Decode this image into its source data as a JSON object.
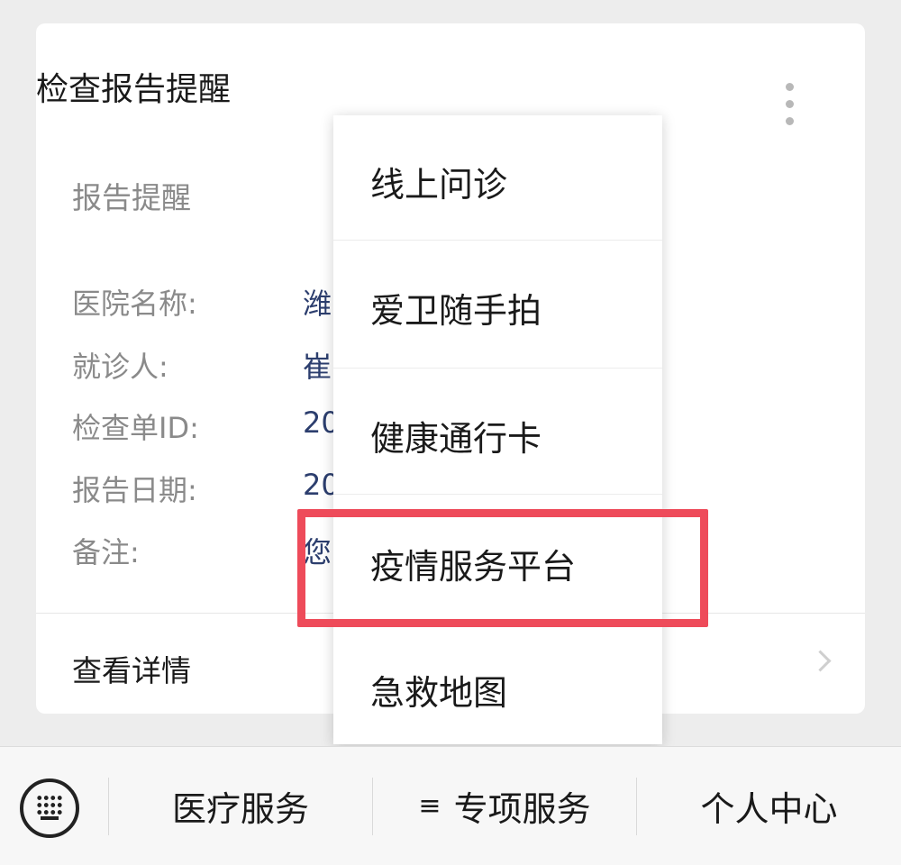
{
  "card": {
    "title": "检查报告提醒",
    "subtitle": "报告提醒",
    "fields": [
      {
        "label": "医院名称:",
        "value": "潍"
      },
      {
        "label": "就诊人:",
        "value": "崔"
      },
      {
        "label": "检查单ID:",
        "value": "20"
      },
      {
        "label": "报告日期:",
        "value": "20"
      },
      {
        "label": "备注:",
        "value": "您"
      }
    ],
    "detail_label": "查看详情"
  },
  "popup_menu": {
    "items": [
      {
        "label": "线上问诊"
      },
      {
        "label": "爱卫随手拍"
      },
      {
        "label": "健康通行卡"
      },
      {
        "label": "疫情服务平台",
        "highlighted": true
      },
      {
        "label": "急救地图"
      }
    ]
  },
  "bottom_bar": {
    "tabs": [
      {
        "label": "医疗服务",
        "icon": ""
      },
      {
        "label": "专项服务",
        "icon": "≡"
      },
      {
        "label": "个人中心",
        "icon": ""
      }
    ]
  },
  "colors": {
    "highlight": "#ee4b5a",
    "background": "#ededed",
    "value_text": "#2c3e6e"
  }
}
